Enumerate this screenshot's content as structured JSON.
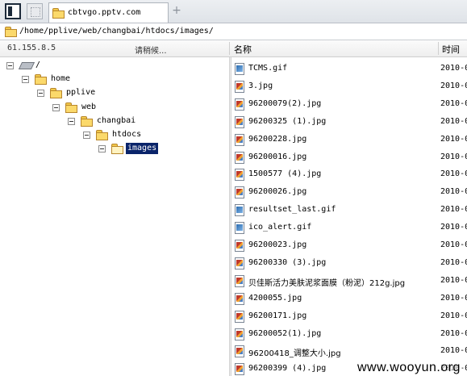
{
  "tab": {
    "title": "cbtvgo.pptv.com",
    "add_label": "+"
  },
  "path": {
    "value": "/home/pplive/web/changbai/htdocs/images/"
  },
  "header": {
    "ip": "61.155.8.5",
    "status": "请稍候...",
    "col_name": "名称",
    "col_time": "时间"
  },
  "tree": [
    {
      "label": "/",
      "icon": "drive-icon",
      "depth": 0
    },
    {
      "label": "home",
      "icon": "folder-icon",
      "depth": 1
    },
    {
      "label": "pplive",
      "icon": "folder-icon",
      "depth": 2
    },
    {
      "label": "web",
      "icon": "folder-icon",
      "depth": 3
    },
    {
      "label": "changbai",
      "icon": "folder-icon",
      "depth": 4
    },
    {
      "label": "htdocs",
      "icon": "folder-icon",
      "depth": 5
    },
    {
      "label": "images",
      "icon": "folder-open-icon",
      "depth": 6,
      "selected": true
    }
  ],
  "files": [
    {
      "name": "TCMS.gif",
      "type": "gif",
      "time": "2010-0"
    },
    {
      "name": "3.jpg",
      "type": "jpg",
      "time": "2010-0"
    },
    {
      "name": "96200079(2).jpg",
      "type": "jpg",
      "time": "2010-0"
    },
    {
      "name": "96200325 (1).jpg",
      "type": "jpg",
      "time": "2010-0"
    },
    {
      "name": "96200228.jpg",
      "type": "jpg",
      "time": "2010-0"
    },
    {
      "name": "96200016.jpg",
      "type": "jpg",
      "time": "2010-0"
    },
    {
      "name": "1500577 (4).jpg",
      "type": "jpg",
      "time": "2010-0"
    },
    {
      "name": "96200026.jpg",
      "type": "jpg",
      "time": "2010-0"
    },
    {
      "name": "resultset_last.gif",
      "type": "gif",
      "time": "2010-0"
    },
    {
      "name": "ico_alert.gif",
      "type": "gif",
      "time": "2010-0"
    },
    {
      "name": "96200023.jpg",
      "type": "jpg",
      "time": "2010-0"
    },
    {
      "name": "96200330 (3).jpg",
      "type": "jpg",
      "time": "2010-0"
    },
    {
      "name": "贝佳斯活力美肤泥浆面膜（粉泥）212g.jpg",
      "type": "jpg",
      "time": "2010-0"
    },
    {
      "name": "4200055.jpg",
      "type": "jpg",
      "time": "2010-0"
    },
    {
      "name": "96200171.jpg",
      "type": "jpg",
      "time": "2010-0"
    },
    {
      "name": "96200052(1).jpg",
      "type": "jpg",
      "time": "2010-0"
    },
    {
      "name": "96200418_调整大小.jpg",
      "type": "jpg",
      "time": "2010-0"
    },
    {
      "name": "96200399 (4).jpg",
      "type": "jpg",
      "time": "2010-0"
    }
  ],
  "watermark": "www.wooyun.org"
}
